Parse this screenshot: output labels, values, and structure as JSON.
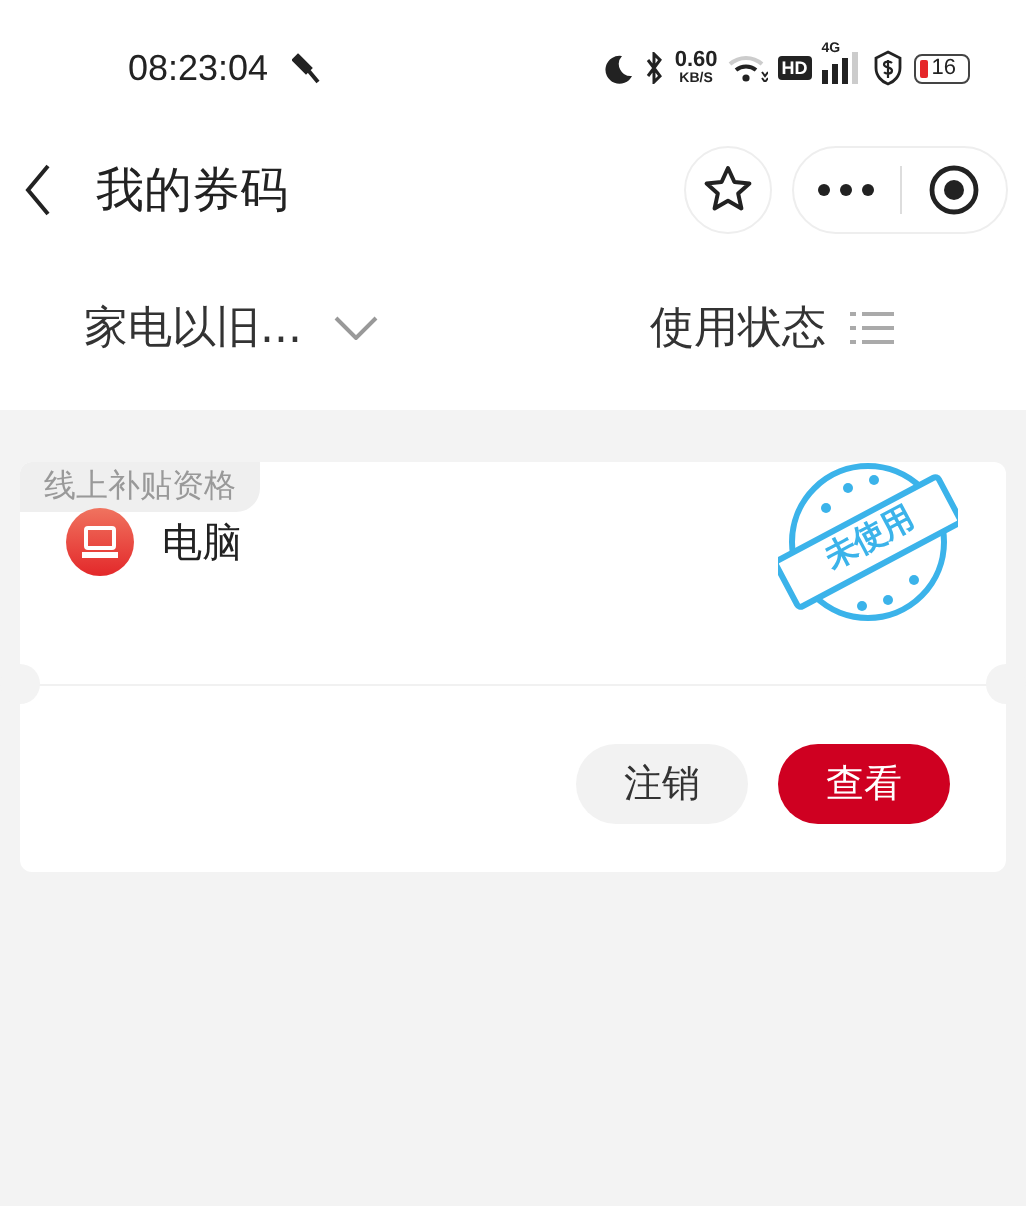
{
  "status_bar": {
    "time": "08:23:04",
    "net_speed": "0.60",
    "net_unit": "KB/S",
    "hd": "HD",
    "network": "4G",
    "battery": "16"
  },
  "nav": {
    "title": "我的券码"
  },
  "filters": [
    {
      "label": "家电以旧...",
      "kind": "dropdown"
    },
    {
      "label": "使用状态",
      "kind": "list"
    }
  ],
  "coupons": [
    {
      "tag": "线上补贴资格",
      "name": "电脑",
      "stamp": "未使用",
      "actions": [
        {
          "label": "注销",
          "kind": "secondary"
        },
        {
          "label": "查看",
          "kind": "primary"
        }
      ]
    }
  ]
}
